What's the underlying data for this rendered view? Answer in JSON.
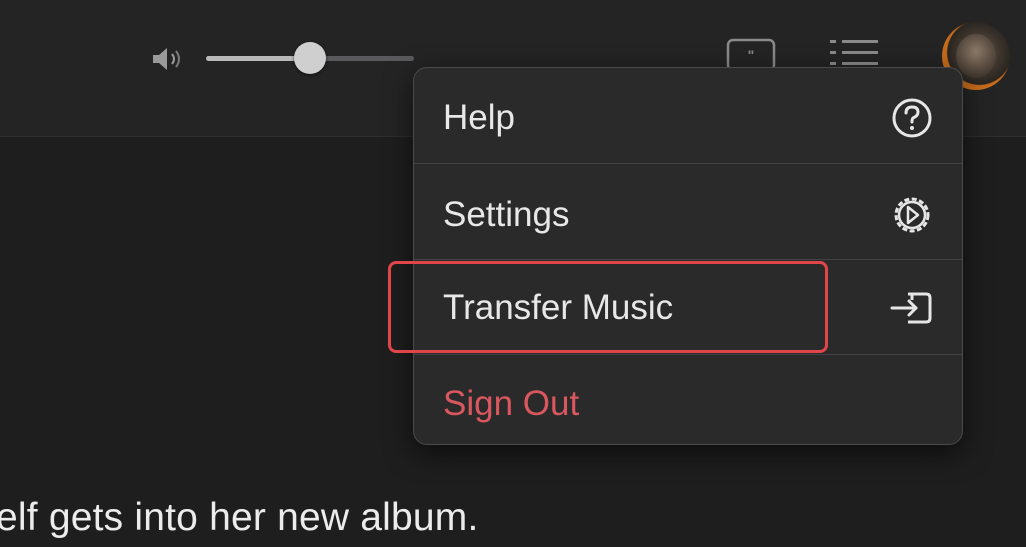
{
  "toolbar": {
    "volume_icon": "speaker-icon",
    "volume_level": 0.5,
    "lyrics_icon": "lyrics-icon",
    "queue_icon": "list-icon",
    "avatar_icon": "user-avatar"
  },
  "menu": {
    "items": [
      {
        "label": "Help",
        "icon": "question-circle-icon"
      },
      {
        "label": "Settings",
        "icon": "gear-icon"
      },
      {
        "label": "Transfer Music",
        "icon": "transfer-icon"
      },
      {
        "label": "Sign Out"
      }
    ]
  },
  "content": {
    "lyric_text": "elf gets into her new album."
  },
  "colors": {
    "background": "#1e1e1f",
    "menu_background": "#2a2a2b",
    "sign_out": "#d9575f",
    "highlight": "#e0454a"
  }
}
